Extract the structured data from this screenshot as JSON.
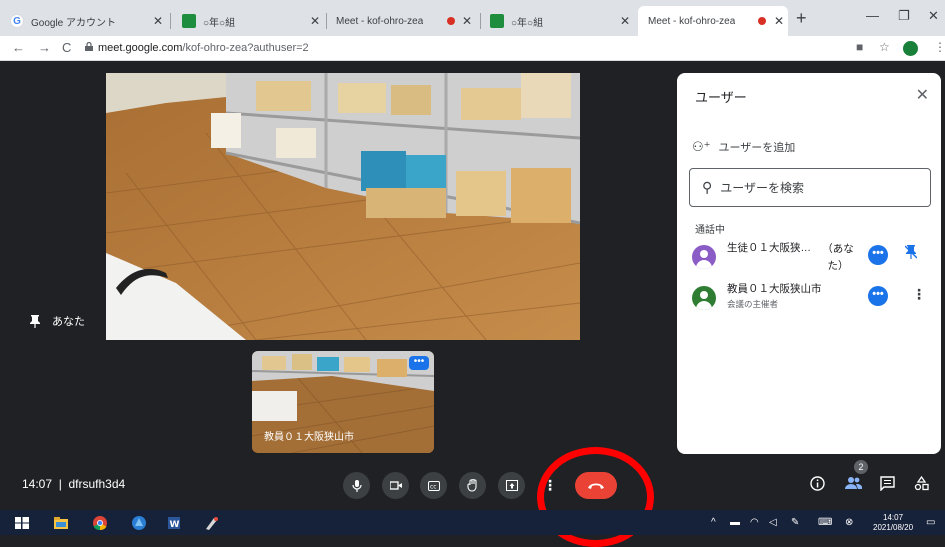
{
  "browser": {
    "tabs": [
      {
        "title": "Google アカウント",
        "type": "google",
        "active": false
      },
      {
        "title": "○年○組",
        "type": "classroom",
        "active": false
      },
      {
        "title": "Meet - kof-ohro-zea",
        "type": "meet",
        "active": false,
        "recording": true
      },
      {
        "title": "○年○組",
        "type": "classroom",
        "active": false
      },
      {
        "title": "Meet - kof-ohro-zea",
        "type": "meet",
        "active": true,
        "recording": true
      }
    ],
    "url_host": "meet.google.com",
    "url_path": "/kof-ohro-zea?authuser=2"
  },
  "meet": {
    "self_label": "あなた",
    "tile_name": "教員０１大阪狭山市",
    "meeting_time": "14:07",
    "meeting_separator": "|",
    "meeting_code": "dfrsufh3d4",
    "participant_count": "2"
  },
  "panel": {
    "title": "ユーザー",
    "add_user": "ユーザーを追加",
    "search_placeholder": "ユーザーを検索",
    "section_label": "通話中",
    "people": [
      {
        "name": "生徒０１大阪狭…",
        "you_line1": "（あな",
        "you_line2": "た）",
        "subtitle": ""
      },
      {
        "name": "教員０１大阪狭山市",
        "subtitle": "会議の主催者"
      }
    ]
  },
  "taskbar": {
    "time": "14:07",
    "date": "2021/08/20"
  },
  "colors": {
    "meet_bg": "#202124",
    "hangup": "#ea4335",
    "annotation_ring": "#ff0000",
    "accent": "#1a73e8"
  }
}
